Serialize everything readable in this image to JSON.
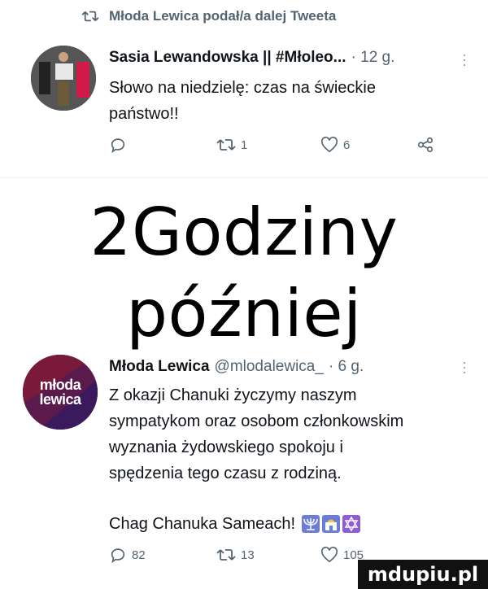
{
  "retweet_context": {
    "label": "Młoda Lewica podał/a dalej Tweeta"
  },
  "tweet1": {
    "author": "Sasia Lewandowska || #Młoleo...",
    "time": "· 12 g.",
    "text_line1": "Słowo na niedzielę: czas na świeckie",
    "text_line2": "państwo!!",
    "retweets": "1",
    "likes": "6"
  },
  "caption": {
    "text": "2Godziny później"
  },
  "tweet2": {
    "author": "Młoda Lewica",
    "handle": "@mlodalewica_",
    "time": "· 6 g.",
    "avatar_text_line1": "młoda",
    "avatar_text_line2": "lewica",
    "text_lines": [
      "Z okazji Chanuki życzymy naszym",
      "sympatykom oraz osobom członkowskim",
      "wyznania żydowskiego spokoju i",
      "spędzenia tego czasu z rodziną."
    ],
    "greeting": "Chag Chanuka Sameach!",
    "replies": "82",
    "retweets": "13",
    "likes": "105"
  },
  "watermark": {
    "text": "mdupiu.pl"
  },
  "colors": {
    "text": "#0f1419",
    "muted": "#536471",
    "avatar_purple": "#6a1a46"
  }
}
